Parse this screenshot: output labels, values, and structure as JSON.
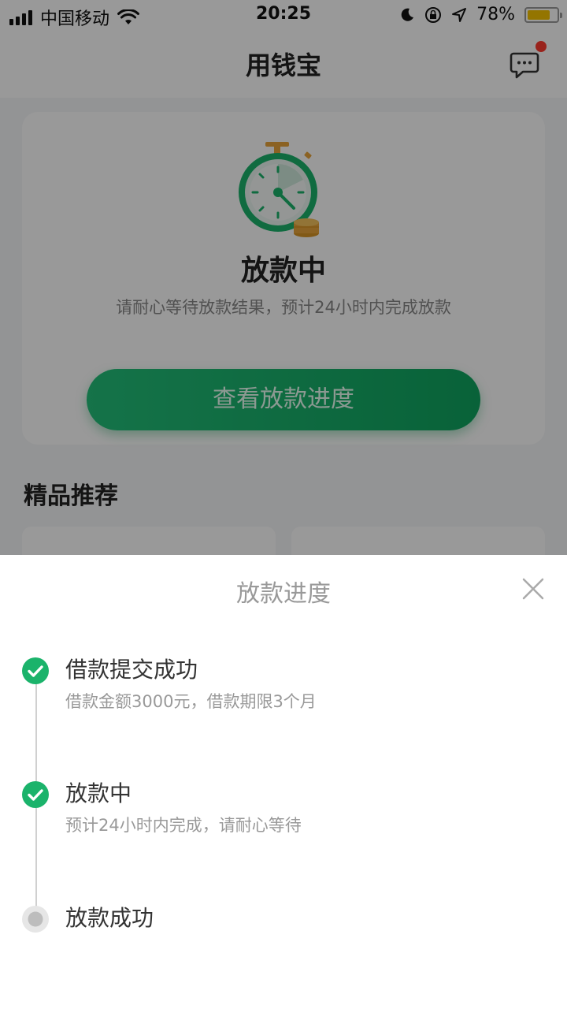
{
  "status_bar": {
    "carrier": "中国移动",
    "time": "20:25",
    "battery": "78%",
    "battery_level": 0.78,
    "battery_color": "#f7c300"
  },
  "nav": {
    "title": "用钱宝",
    "message_icon": "chat-bubble-icon",
    "has_notification": true
  },
  "loan_card": {
    "status_title": "放款中",
    "description": "请耐心等待放款结果，预计24小时内完成放款",
    "button_label": "查看放款进度",
    "accent_color": "#1bb36b"
  },
  "recommend": {
    "title": "精品推荐"
  },
  "sheet": {
    "title": "放款进度",
    "steps": [
      {
        "label": "借款提交成功",
        "detail": "借款金额3000元，借款期限3个月",
        "done": true
      },
      {
        "label": "放款中",
        "detail": "预计24小时内完成，请耐心等待",
        "done": true
      },
      {
        "label": "放款成功",
        "detail": "",
        "done": false
      }
    ]
  }
}
